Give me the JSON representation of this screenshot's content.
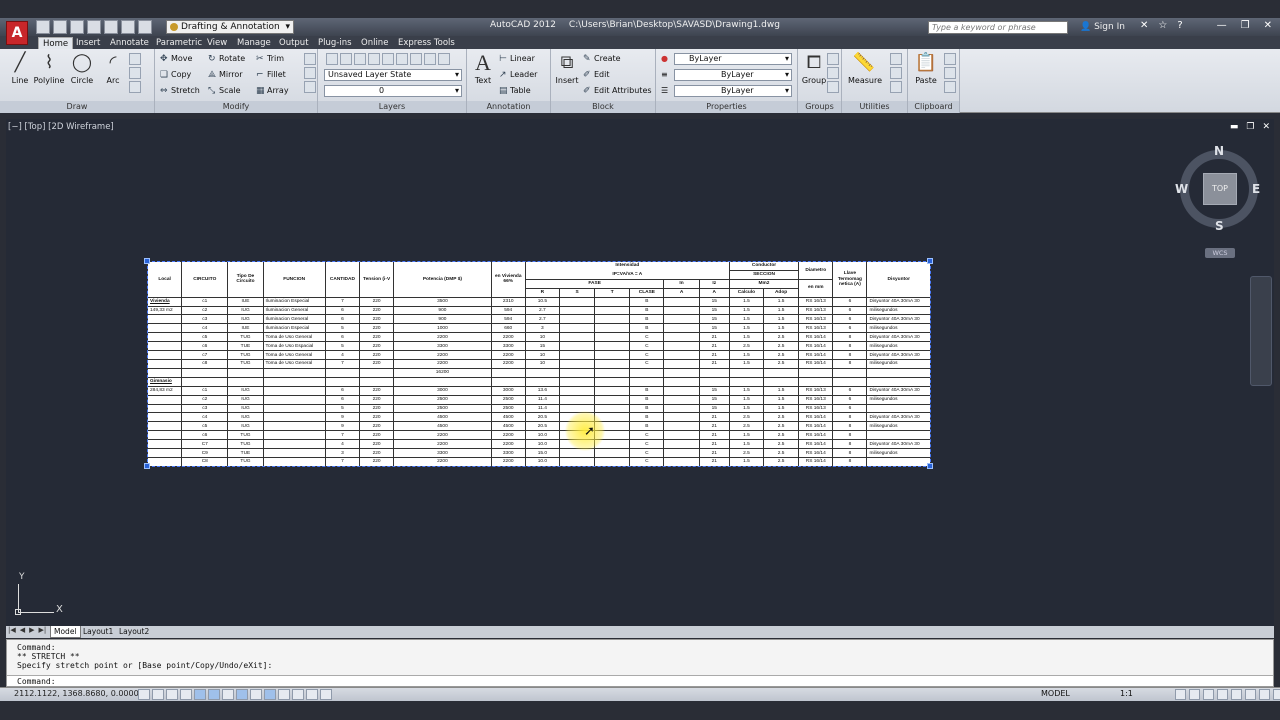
{
  "titlebar": {
    "workspace": "Drafting & Annotation",
    "app_name": "AutoCAD 2012",
    "file_path": "C:\\Users\\Brian\\Desktop\\SAVASD\\Drawing1.dwg",
    "search_placeholder": "Type a keyword or phrase",
    "sign_in": "Sign In"
  },
  "ribbon_tabs": [
    "Home",
    "Insert",
    "Annotate",
    "Parametric",
    "View",
    "Manage",
    "Output",
    "Plug-ins",
    "Online",
    "Express Tools"
  ],
  "ribbon": {
    "draw": {
      "title": "Draw",
      "tools": [
        "Line",
        "Polyline",
        "Circle",
        "Arc"
      ]
    },
    "modify": {
      "title": "Modify",
      "tools": [
        "Move",
        "Rotate",
        "Trim",
        "Copy",
        "Mirror",
        "Fillet",
        "Stretch",
        "Scale",
        "Array"
      ]
    },
    "layers": {
      "title": "Layers",
      "layer_state": "Unsaved Layer State",
      "current_layer": "0"
    },
    "annotation": {
      "title": "Annotation",
      "text": "Text",
      "linear": "Linear",
      "leader": "Leader",
      "table": "Table"
    },
    "block": {
      "title": "Block",
      "insert": "Insert",
      "create": "Create",
      "edit": "Edit",
      "edit_attributes": "Edit Attributes"
    },
    "properties": {
      "title": "Properties",
      "color": "ByLayer",
      "linetype": "ByLayer",
      "lineweight": "ByLayer"
    },
    "groups": {
      "title": "Groups",
      "group": "Group"
    },
    "utilities": {
      "title": "Utilities",
      "measure": "Measure"
    },
    "clipboard": {
      "title": "Clipboard",
      "paste": "Paste"
    }
  },
  "viewport": {
    "label": "[−] [Top] [2D Wireframe]",
    "viewcube": {
      "face": "TOP",
      "n": "N",
      "s": "S",
      "e": "E",
      "w": "W",
      "wcs": "WCS"
    },
    "ucs": {
      "x": "X",
      "y": "Y"
    }
  },
  "drawing_table": {
    "headers": {
      "local": "Local",
      "circuito": "CIRCUITO",
      "tipo": "Tipo De Circuito",
      "funcion": "FUNCION",
      "cantidad": "CANTIDAD",
      "tension": "Tension (i-V",
      "potencia": "Potencia (DMP $)",
      "en_vivienda": "en Vivienda 66%",
      "intensidad": "Intensidad",
      "formula": "IP=VA/VA = A",
      "fase": "FASE",
      "r": "R",
      "s": "S",
      "t": "T",
      "clase": "CLASE",
      "in": "In",
      "a1": "A",
      "iz": "Iz",
      "a2": "A",
      "conductor": "Conductor",
      "seccion": "SECCION",
      "mm2": "Mm2",
      "calculo": "Calculo",
      "adop": "Adop",
      "diametro": "Diametro",
      "enmm": "en mm",
      "llave": "Llave Termomag netica (A)",
      "disyuntor": "Disyuntor"
    },
    "rows": [
      {
        "local": "Vivienda",
        "c": "c1",
        "tipo": "IUE",
        "funcion": "Iluminacion Especial",
        "cant": "7",
        "v": "220",
        "pot": "3500",
        "viv": "2310",
        "r": "10.5",
        "s": "",
        "t": "",
        "clase": "B",
        "in": "",
        "iz": "15",
        "calc": "1.5",
        "adop": "1.5",
        "diam": "RS 16/13",
        "llave": "6",
        "disy": "Disyuntor 40A 30mA 30"
      },
      {
        "local": "149,33 m2",
        "c": "c2",
        "tipo": "IUG",
        "funcion": "Iluminacion General",
        "cant": "6",
        "v": "220",
        "pot": "900",
        "viv": "594",
        "r": "2.7",
        "s": "",
        "t": "",
        "clase": "B",
        "in": "",
        "iz": "15",
        "calc": "1.5",
        "adop": "1.5",
        "diam": "RS 16/13",
        "llave": "6",
        "disy": "milisegundos"
      },
      {
        "local": "",
        "c": "c3",
        "tipo": "IUG",
        "funcion": "Iluminacion General",
        "cant": "6",
        "v": "220",
        "pot": "900",
        "viv": "594",
        "r": "2.7",
        "s": "",
        "t": "",
        "clase": "B",
        "in": "",
        "iz": "15",
        "calc": "1.5",
        "adop": "1.5",
        "diam": "RS 16/13",
        "llave": "6",
        "disy": "Disyuntor 40A 30mA 30"
      },
      {
        "local": "",
        "c": "c4",
        "tipo": "IUE",
        "funcion": "Iluminacion Especial",
        "cant": "5",
        "v": "220",
        "pot": "1000",
        "viv": "660",
        "r": "3",
        "s": "",
        "t": "",
        "clase": "B",
        "in": "",
        "iz": "15",
        "calc": "1.5",
        "adop": "1.5",
        "diam": "RS 16/13",
        "llave": "6",
        "disy": "milisegundos"
      },
      {
        "local": "",
        "c": "c5",
        "tipo": "TUG",
        "funcion": "Toma de Uso General",
        "cant": "6",
        "v": "220",
        "pot": "2200",
        "viv": "2200",
        "r": "10",
        "s": "",
        "t": "",
        "clase": "C",
        "in": "",
        "iz": "21",
        "calc": "1.5",
        "adop": "2.5",
        "diam": "RS 16/14",
        "llave": "8",
        "disy": "Disyuntor 40A 30mA 30"
      },
      {
        "local": "",
        "c": "c6",
        "tipo": "TUE",
        "funcion": "Toma de Uso Espacial",
        "cant": "5",
        "v": "220",
        "pot": "3300",
        "viv": "3300",
        "r": "15",
        "s": "",
        "t": "",
        "clase": "C",
        "in": "",
        "iz": "21",
        "calc": "2.5",
        "adop": "2.5",
        "diam": "RS 16/14",
        "llave": "8",
        "disy": "milisegundos"
      },
      {
        "local": "",
        "c": "c7",
        "tipo": "TUG",
        "funcion": "Toma de Uso General",
        "cant": "4",
        "v": "220",
        "pot": "2200",
        "viv": "2200",
        "r": "10",
        "s": "",
        "t": "",
        "clase": "C",
        "in": "",
        "iz": "21",
        "calc": "1.5",
        "adop": "2.5",
        "diam": "RS 16/14",
        "llave": "8",
        "disy": "Disyuntor 40A 30mA 30"
      },
      {
        "local": "",
        "c": "c8",
        "tipo": "TUG",
        "funcion": "Toma de Uso General",
        "cant": "7",
        "v": "220",
        "pot": "2200",
        "viv": "2200",
        "r": "10",
        "s": "",
        "t": "",
        "clase": "C",
        "in": "",
        "iz": "21",
        "calc": "1.5",
        "adop": "2.5",
        "diam": "RS 16/14",
        "llave": "8",
        "disy": "milisegundos"
      },
      {
        "local": "",
        "c": "",
        "tipo": "",
        "funcion": "",
        "cant": "",
        "v": "",
        "pot": "16200",
        "viv": "",
        "r": "",
        "s": "",
        "t": "",
        "clase": "",
        "in": "",
        "iz": "",
        "calc": "",
        "adop": "",
        "diam": "",
        "llave": "",
        "disy": ""
      },
      {
        "local": "Gimnasio",
        "c": "",
        "tipo": "",
        "funcion": "",
        "cant": "",
        "v": "",
        "pot": "",
        "viv": "",
        "r": "",
        "s": "",
        "t": "",
        "clase": "",
        "in": "",
        "iz": "",
        "calc": "",
        "adop": "",
        "diam": "",
        "llave": "",
        "disy": ""
      },
      {
        "local": "284,83 m2",
        "c": "c1",
        "tipo": "IUG",
        "funcion": "",
        "cant": "6",
        "v": "220",
        "pot": "3000",
        "viv": "3000",
        "r": "13.6",
        "s": "",
        "t": "",
        "clase": "B",
        "in": "",
        "iz": "15",
        "calc": "1.5",
        "adop": "1.5",
        "diam": "RS 16/13",
        "llave": "6",
        "disy": "Disyuntor 40A 30mA 30"
      },
      {
        "local": "",
        "c": "c2",
        "tipo": "IUG",
        "funcion": "",
        "cant": "6",
        "v": "220",
        "pot": "2500",
        "viv": "2500",
        "r": "11.4",
        "s": "",
        "t": "",
        "clase": "B",
        "in": "",
        "iz": "15",
        "calc": "1.5",
        "adop": "1.5",
        "diam": "RS 16/13",
        "llave": "6",
        "disy": "milisegundos"
      },
      {
        "local": "",
        "c": "c3",
        "tipo": "IUG",
        "funcion": "",
        "cant": "5",
        "v": "220",
        "pot": "2500",
        "viv": "2500",
        "r": "11.4",
        "s": "",
        "t": "",
        "clase": "B",
        "in": "",
        "iz": "15",
        "calc": "1.5",
        "adop": "1.5",
        "diam": "RS 16/13",
        "llave": "6",
        "disy": ""
      },
      {
        "local": "",
        "c": "c4",
        "tipo": "IUG",
        "funcion": "",
        "cant": "9",
        "v": "220",
        "pot": "4500",
        "viv": "4500",
        "r": "20.5",
        "s": "",
        "t": "",
        "clase": "B",
        "in": "",
        "iz": "21",
        "calc": "2.5",
        "adop": "2.5",
        "diam": "RS 16/14",
        "llave": "8",
        "disy": "Disyuntor 40A 30mA 30"
      },
      {
        "local": "",
        "c": "c5",
        "tipo": "IUG",
        "funcion": "",
        "cant": "9",
        "v": "220",
        "pot": "4500",
        "viv": "4500",
        "r": "20.5",
        "s": "",
        "t": "",
        "clase": "B",
        "in": "",
        "iz": "21",
        "calc": "2.5",
        "adop": "2.5",
        "diam": "RS 16/14",
        "llave": "8",
        "disy": "milisegundos"
      },
      {
        "local": "",
        "c": "c6",
        "tipo": "TUG",
        "funcion": "",
        "cant": "7",
        "v": "220",
        "pot": "2200",
        "viv": "2200",
        "r": "10.0",
        "s": "",
        "t": "",
        "clase": "C",
        "in": "",
        "iz": "21",
        "calc": "1.5",
        "adop": "2.5",
        "diam": "RS 16/14",
        "llave": "8",
        "disy": ""
      },
      {
        "local": "",
        "c": "C7",
        "tipo": "TUG",
        "funcion": "",
        "cant": "4",
        "v": "220",
        "pot": "2200",
        "viv": "2200",
        "r": "10.0",
        "s": "",
        "t": "",
        "clase": "C",
        "in": "",
        "iz": "21",
        "calc": "1.5",
        "adop": "2.5",
        "diam": "RS 16/14",
        "llave": "8",
        "disy": "Disyuntor 40A 30mA 30"
      },
      {
        "local": "",
        "c": "C9",
        "tipo": "TUE",
        "funcion": "",
        "cant": "3",
        "v": "220",
        "pot": "3300",
        "viv": "3300",
        "r": "15.0",
        "s": "",
        "t": "",
        "clase": "C",
        "in": "",
        "iz": "21",
        "calc": "2.5",
        "adop": "2.5",
        "diam": "RS 16/14",
        "llave": "8",
        "disy": "milisegundos"
      },
      {
        "local": "",
        "c": "C8",
        "tipo": "TUG",
        "funcion": "",
        "cant": "7",
        "v": "220",
        "pot": "2200",
        "viv": "2200",
        "r": "10.0",
        "s": "",
        "t": "",
        "clase": "C",
        "in": "",
        "iz": "21",
        "calc": "1.5",
        "adop": "2.5",
        "diam": "RS 16/14",
        "llave": "8",
        "disy": ""
      }
    ]
  },
  "layout_tabs": [
    "Model",
    "Layout1",
    "Layout2"
  ],
  "command": {
    "history": [
      "Command:",
      "** STRETCH **",
      "Specify stretch point or [Base point/Copy/Undo/eXit]:"
    ],
    "prompt": "Command:"
  },
  "status": {
    "coords": "2112.1122, 1368.8680, 0.0000",
    "model": "MODEL",
    "scale": "1:1"
  }
}
